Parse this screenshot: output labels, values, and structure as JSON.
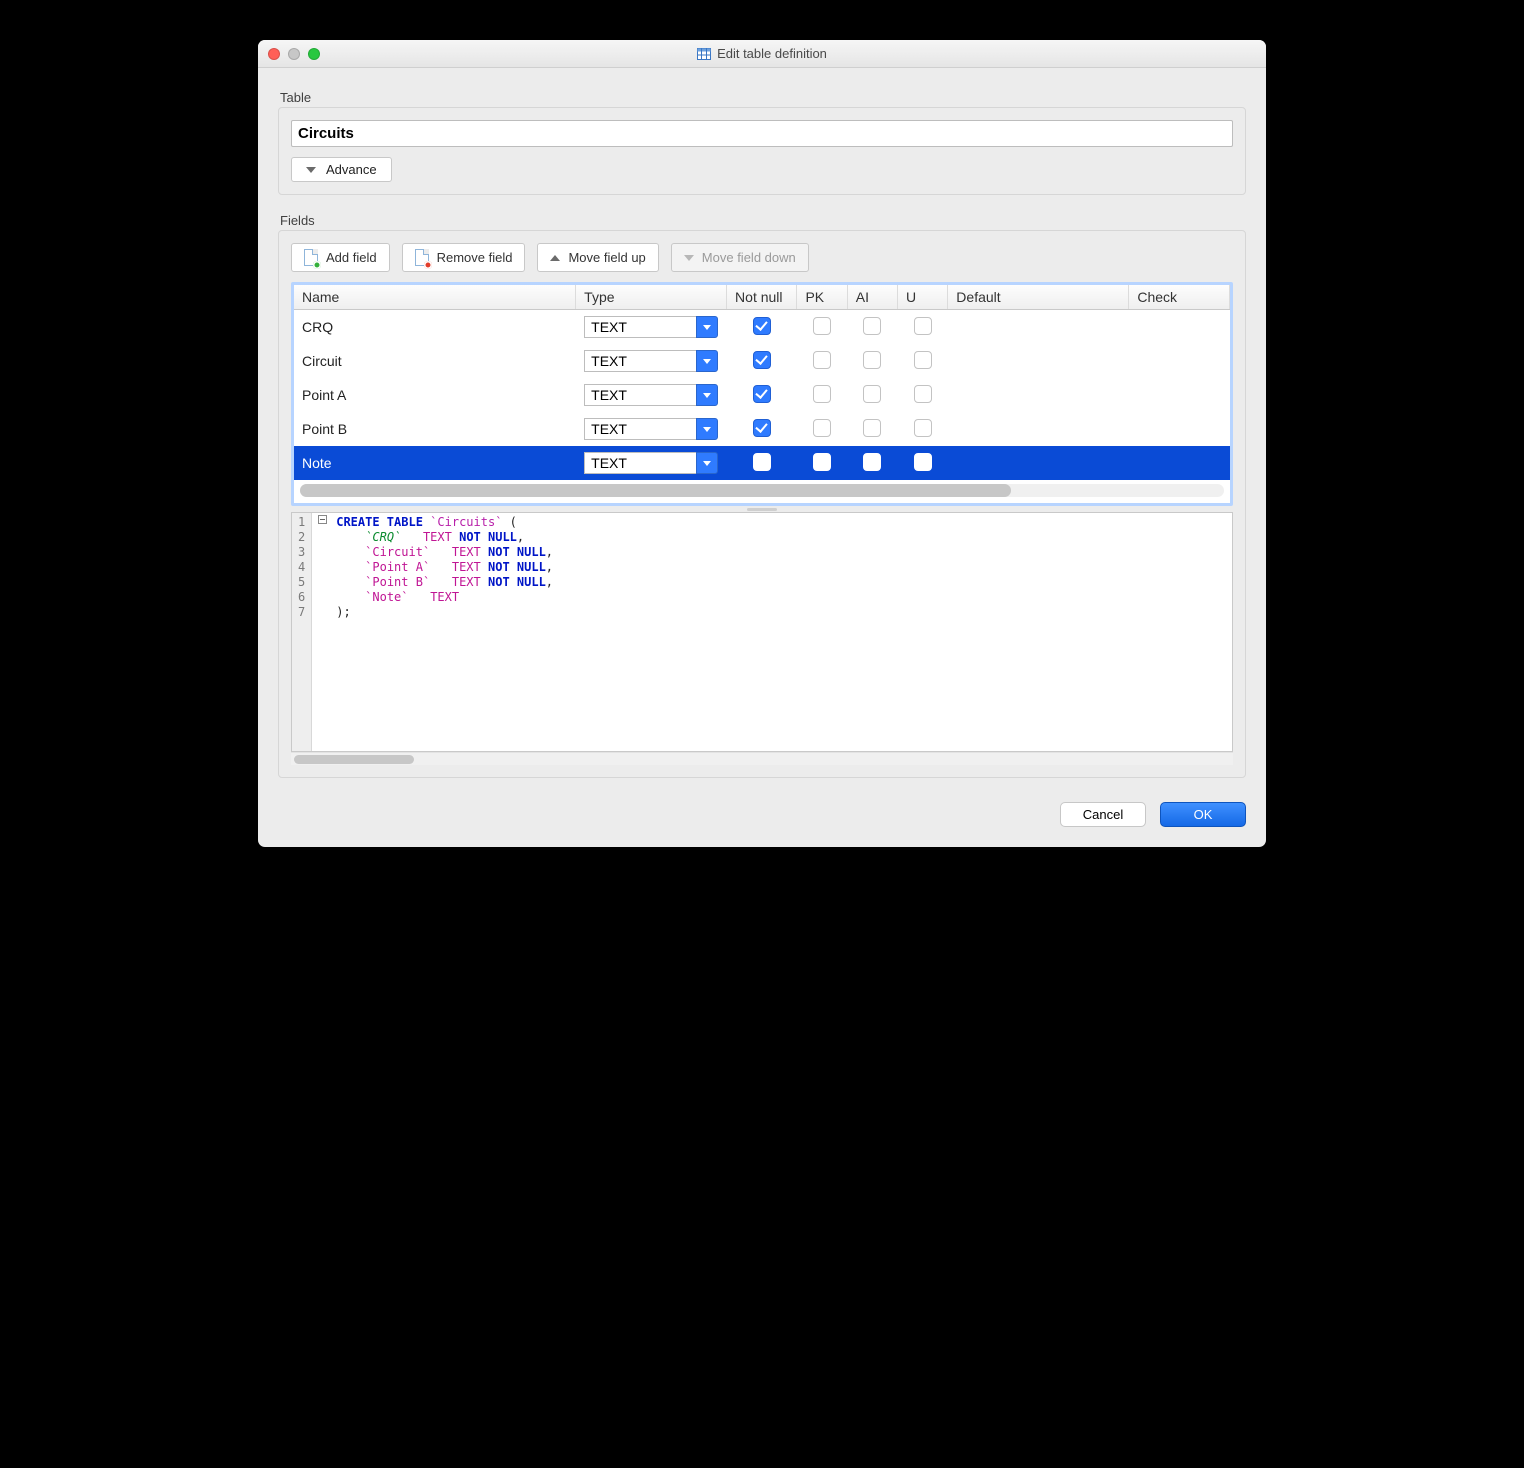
{
  "window": {
    "title": "Edit table definition"
  },
  "table_section": {
    "label": "Table",
    "name_value": "Circuits",
    "advance_label": "Advance"
  },
  "fields_section": {
    "label": "Fields",
    "toolbar": {
      "add": "Add field",
      "remove": "Remove field",
      "move_up": "Move field up",
      "move_down": "Move field down"
    },
    "columns": {
      "name": "Name",
      "type": "Type",
      "notnull": "Not null",
      "pk": "PK",
      "ai": "AI",
      "u": "U",
      "def": "Default",
      "check": "Check"
    },
    "rows": [
      {
        "name": "CRQ",
        "type": "TEXT",
        "notnull": true,
        "pk": false,
        "ai": false,
        "u": false,
        "default": "",
        "check": "",
        "selected": false
      },
      {
        "name": "Circuit",
        "type": "TEXT",
        "notnull": true,
        "pk": false,
        "ai": false,
        "u": false,
        "default": "",
        "check": "",
        "selected": false
      },
      {
        "name": "Point A",
        "type": "TEXT",
        "notnull": true,
        "pk": false,
        "ai": false,
        "u": false,
        "default": "",
        "check": "",
        "selected": false
      },
      {
        "name": "Point B",
        "type": "TEXT",
        "notnull": true,
        "pk": false,
        "ai": false,
        "u": false,
        "default": "",
        "check": "",
        "selected": false
      },
      {
        "name": "Note",
        "type": "TEXT",
        "notnull": false,
        "pk": false,
        "ai": false,
        "u": false,
        "default": "",
        "check": "",
        "selected": true
      }
    ]
  },
  "sql": {
    "lines": [
      "1",
      "2",
      "3",
      "4",
      "5",
      "6",
      "7"
    ],
    "create": "CREATE TABLE",
    "table_name": "`Circuits`",
    "cols": [
      {
        "name": "`CRQ`",
        "type": "TEXT",
        "nn": "NOT NULL"
      },
      {
        "name": "`Circuit`",
        "type": "TEXT",
        "nn": "NOT NULL"
      },
      {
        "name": "`Point A`",
        "type": "TEXT",
        "nn": "NOT NULL"
      },
      {
        "name": "`Point B`",
        "type": "TEXT",
        "nn": "NOT NULL"
      },
      {
        "name": "`Note`",
        "type": "TEXT",
        "nn": ""
      }
    ],
    "close": ");"
  },
  "footer": {
    "cancel": "Cancel",
    "ok": "OK"
  }
}
